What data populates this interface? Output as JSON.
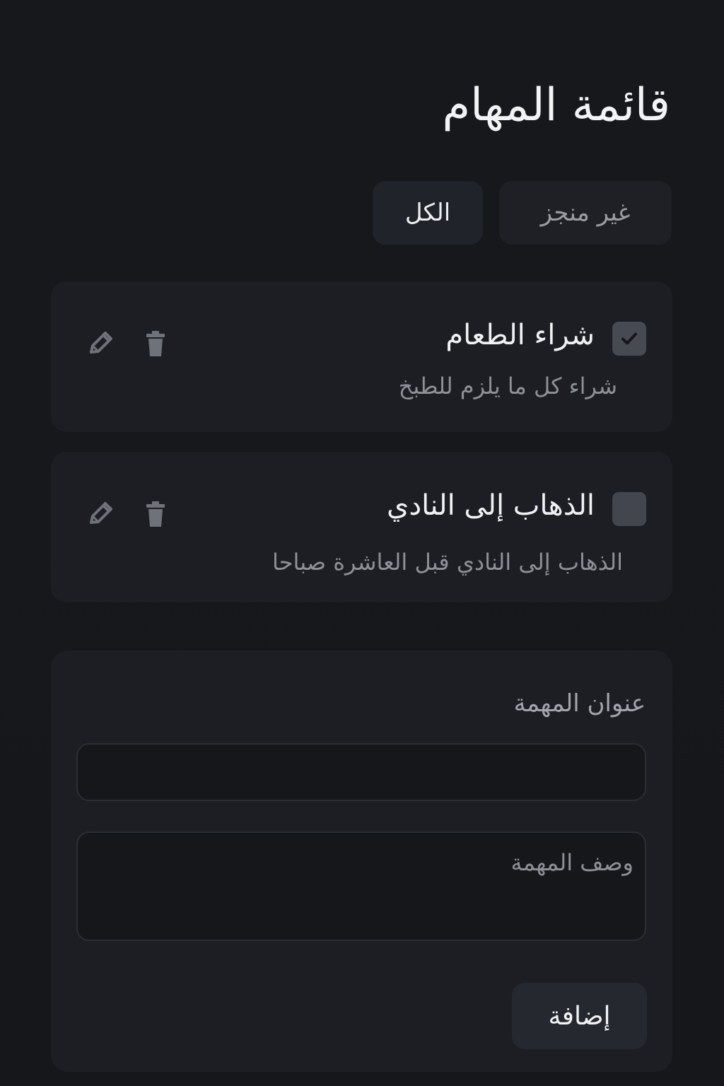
{
  "app": {
    "title": "قائمة المهام"
  },
  "filters": {
    "all_label": "الكل",
    "incomplete_label": "غير منجز"
  },
  "tasks": [
    {
      "title": "شراء الطعام",
      "description": "شراء كل ما يلزم للطبخ",
      "completed": true,
      "edit_icon": "pencil-icon",
      "delete_icon": "trash-icon"
    },
    {
      "title": "الذهاب إلى النادي",
      "description": "الذهاب إلى النادي قبل العاشرة صباحا",
      "completed": false,
      "edit_icon": "pencil-icon",
      "delete_icon": "trash-icon"
    }
  ],
  "form": {
    "title_label": "عنوان المهمة",
    "title_value": "",
    "description_placeholder": "وصف المهمة",
    "add_button_label": "إضافة"
  },
  "colors": {
    "background": "#15171b",
    "card": "#1c1e23",
    "button": "#202329",
    "muted_text": "#8d9096",
    "icon": "#6f7278"
  }
}
